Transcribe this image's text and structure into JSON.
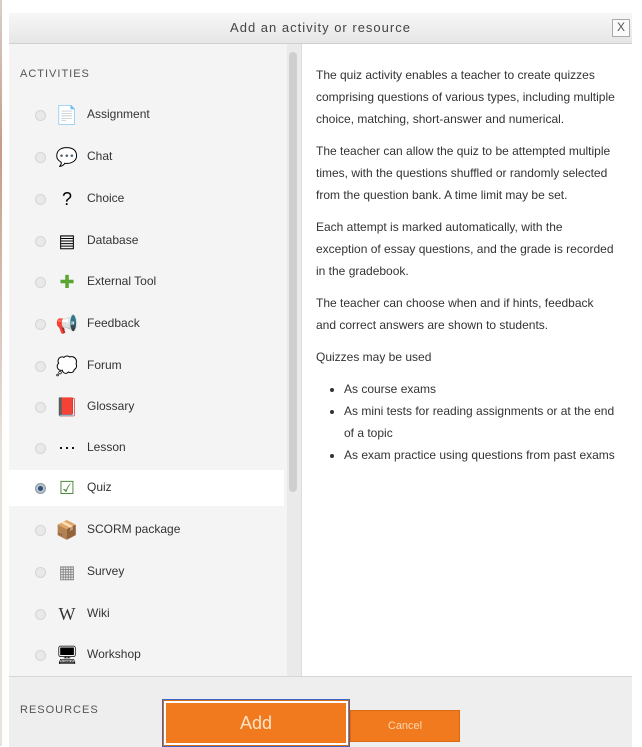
{
  "dialog": {
    "title": "Add an activity or resource",
    "close_label": "X"
  },
  "sections": {
    "activities": "ACTIVITIES",
    "resources": "RESOURCES"
  },
  "activities": [
    {
      "label": "Assignment",
      "icon": "assignment-icon",
      "glyph": "📄",
      "selected": false
    },
    {
      "label": "Chat",
      "icon": "chat-icon",
      "glyph": "💬",
      "selected": false
    },
    {
      "label": "Choice",
      "icon": "choice-icon",
      "glyph": "?",
      "selected": false
    },
    {
      "label": "Database",
      "icon": "database-icon",
      "glyph": "▤",
      "selected": false
    },
    {
      "label": "External Tool",
      "icon": "puzzle-icon",
      "glyph": "✚",
      "selected": false
    },
    {
      "label": "Feedback",
      "icon": "megaphone-icon",
      "glyph": "📢",
      "selected": false
    },
    {
      "label": "Forum",
      "icon": "forum-icon",
      "glyph": "💭",
      "selected": false
    },
    {
      "label": "Glossary",
      "icon": "glossary-icon",
      "glyph": "📕",
      "selected": false
    },
    {
      "label": "Lesson",
      "icon": "lesson-icon",
      "glyph": "⋯",
      "selected": false
    },
    {
      "label": "Quiz",
      "icon": "quiz-icon",
      "glyph": "☑",
      "selected": true
    },
    {
      "label": "SCORM package",
      "icon": "scorm-icon",
      "glyph": "📦",
      "selected": false
    },
    {
      "label": "Survey",
      "icon": "survey-icon",
      "glyph": "▦",
      "selected": false
    },
    {
      "label": "Wiki",
      "icon": "wiki-icon",
      "glyph": "W",
      "selected": false
    },
    {
      "label": "Workshop",
      "icon": "workshop-icon",
      "glyph": "🖥",
      "selected": false
    }
  ],
  "description": {
    "p1": "The quiz activity enables a teacher to create quizzes comprising questions of various types, including multiple choice, matching, short-answer and numerical.",
    "p2": "The teacher can allow the quiz to be attempted multiple times, with the questions shuffled or randomly selected from the question bank. A time limit may be set.",
    "p3": "Each attempt is marked automatically, with the exception of essay questions, and the grade is recorded in the gradebook.",
    "p4": "The teacher can choose when and if hints, feedback and correct answers are shown to students.",
    "p5": "Quizzes may be used",
    "bullets": [
      "As course exams",
      "As mini tests for reading assignments or at the end of a topic",
      "As exam practice using questions from past exams"
    ]
  },
  "footer": {
    "add_label": "Add",
    "cancel_label": "Cancel"
  },
  "colors": {
    "accent": "#f07a1d",
    "selected_bg": "#ffffff",
    "pane_bg": "#f4f4f4"
  }
}
